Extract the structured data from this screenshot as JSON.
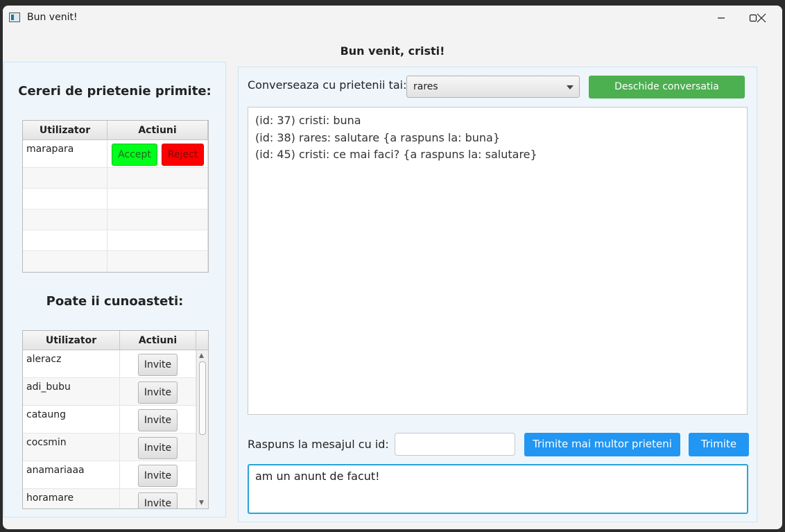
{
  "window": {
    "title": "Bun venit!"
  },
  "welcome": "Bun venit, cristi!",
  "requests": {
    "heading": "Cereri de prietenie primite:",
    "columns": [
      "Utilizator",
      "Actiuni"
    ],
    "rows": [
      {
        "user": "marapara",
        "accept_label": "Accept",
        "reject_label": "Reject"
      }
    ]
  },
  "suggestions": {
    "heading": "Poate ii cunoasteti:",
    "columns": [
      "Utilizator",
      "Actiuni"
    ],
    "invite_label": "Invite",
    "rows": [
      "aleracz",
      "adi_bubu",
      "cataung",
      "cocsmin",
      "anamariaaa",
      "horamare"
    ]
  },
  "chat": {
    "friends_label": "Converseaza cu prietenii tai:",
    "selected_friend": "rares",
    "open_button": "Deschide conversatia",
    "messages": [
      "(id: 37) cristi: buna",
      "(id: 38) rares: salutare {a raspuns la: buna}",
      "(id: 45) cristi: ce mai faci? {a raspuns la: salutare}"
    ],
    "reply_label": "Raspuns la mesajul cu id:",
    "reply_value": "",
    "send_many_button": "Trimite mai multor prieteni",
    "send_button": "Trimite",
    "compose_text": "am un anunt de facut!"
  },
  "colors": {
    "accept": "#00ff1a",
    "reject": "#ff0000",
    "open_conversation": "#4caf50",
    "send": "#2196f3",
    "panel_bg": "#eef6fc"
  }
}
